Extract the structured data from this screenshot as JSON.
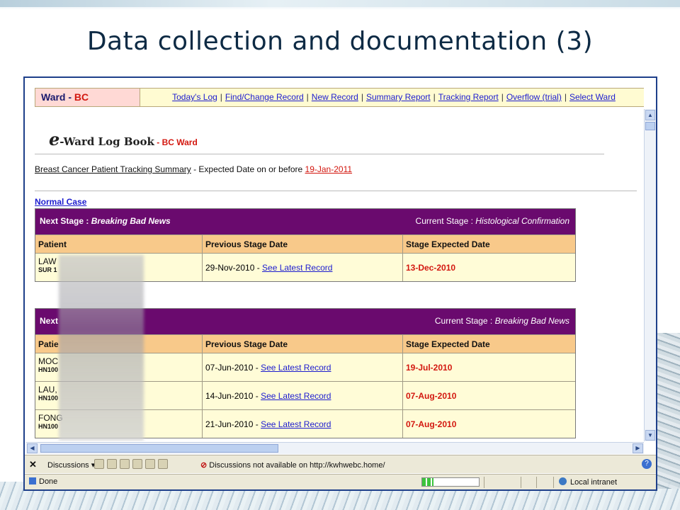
{
  "slide": {
    "title": "Data collection and documentation (3)"
  },
  "topbar": {
    "ward_prefix": "Ward - ",
    "ward_code": "BC",
    "nav": [
      "Today's Log",
      "Find/Change Record",
      "New Record",
      "Summary Report",
      "Tracking Report",
      "Overflow (trial)",
      "Select Ward"
    ]
  },
  "logo": {
    "e": "e",
    "text": "-Ward Log Book",
    "ward": " - BC Ward"
  },
  "summary": {
    "title": "Breast Cancer Patient Tracking Summary",
    "text": " - Expected Date on or before ",
    "date": "19-Jan-2011"
  },
  "section": {
    "normal_case": "Normal Case"
  },
  "tables": [
    {
      "next_stage_prefix": "Next Stage : ",
      "next_stage": "Breaking Bad News",
      "current_stage_prefix": "Current Stage : ",
      "current_stage": "Histological Confirmation",
      "columns": [
        "Patient",
        "Previous Stage Date",
        "Stage Expected Date"
      ],
      "rows": [
        {
          "name": "LAW",
          "id": "SUR 1",
          "prev_date": "29-Nov-2010",
          "link": "See Latest Record",
          "expected": "13-Dec-2010"
        }
      ]
    },
    {
      "next_stage_prefix": "Next",
      "next_stage": "",
      "current_stage_prefix": "Current Stage : ",
      "current_stage": "Breaking Bad News",
      "columns": [
        "Patie",
        "Previous Stage Date",
        "Stage Expected Date"
      ],
      "rows": [
        {
          "name": "MOC",
          "id": "HN100",
          "prev_date": "07-Jun-2010",
          "link": "See Latest Record",
          "expected": "19-Jul-2010"
        },
        {
          "name": "LAU,",
          "id": "HN100",
          "prev_date": "14-Jun-2010",
          "link": "See Latest Record",
          "expected": "07-Aug-2010"
        },
        {
          "name": "FONG",
          "id": "HN100",
          "prev_date": "21-Jun-2010",
          "link": "See Latest Record",
          "expected": "07-Aug-2010"
        }
      ]
    }
  ],
  "discussions": {
    "close": "✕",
    "label": "Discussions ▾",
    "not_available": "Discussions not available on http://kwhwebc.home/",
    "help": "?"
  },
  "status": {
    "done": "Done",
    "zone": "Local intranet",
    "progress": 0.2
  },
  "colors": {
    "title": "#0d2a44",
    "header_purple": "#6a0a6e",
    "column_header": "#f8c98a",
    "row_bg": "#fffcd7",
    "alert_red": "#d3170f",
    "link_blue": "#1c1ccf"
  }
}
